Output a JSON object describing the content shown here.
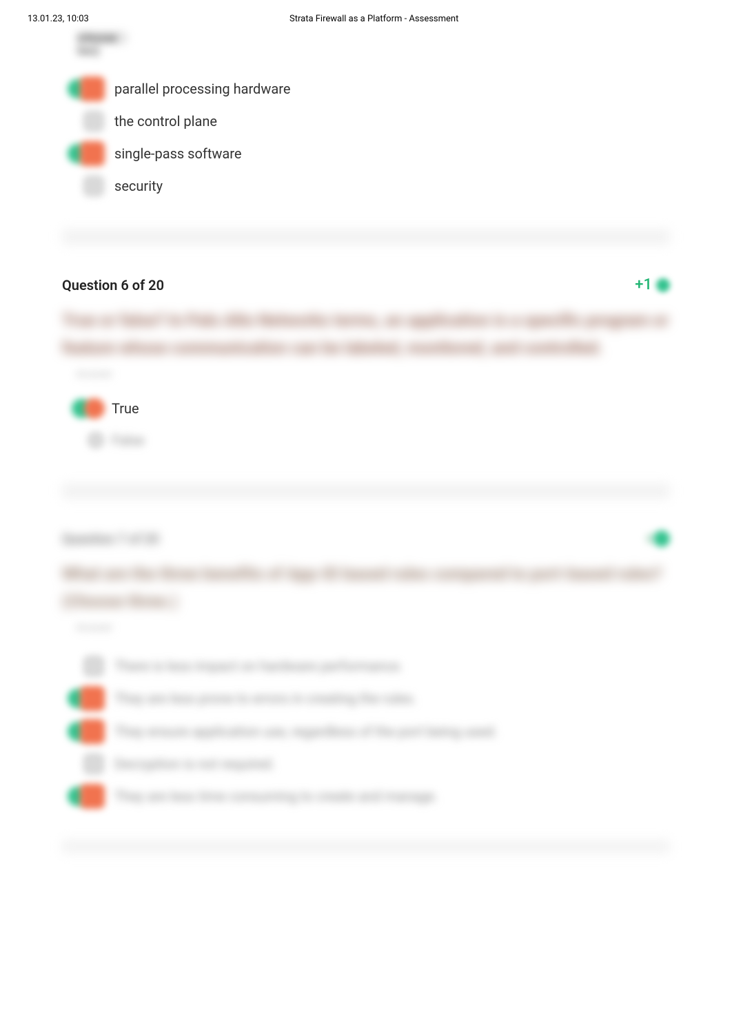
{
  "header": {
    "datetime": "13.01.23, 10:03",
    "title": "Strata Firewall as a Platform - Assessment"
  },
  "q5": {
    "hint": "(choose two)",
    "options": [
      {
        "text": "parallel processing hardware",
        "correct": true,
        "selected": true
      },
      {
        "text": "the control plane",
        "correct": false,
        "selected": false
      },
      {
        "text": "single-pass software",
        "correct": true,
        "selected": true
      },
      {
        "text": "security",
        "correct": false,
        "selected": false
      }
    ]
  },
  "q6": {
    "title": "Question 6 of 20",
    "score": "+1",
    "prompt": "True or false? In Palo Alto Networks terms, an application is a specific program or feature whose communication can be labeled, monitored, and controlled.",
    "hint": "Answer",
    "options": [
      {
        "text": "True",
        "correct": true,
        "selected": true
      },
      {
        "text": "False",
        "correct": false,
        "selected": false
      }
    ]
  },
  "q7": {
    "title": "Question 7 of 20",
    "score": "+1",
    "prompt": "What are the three benefits of App-ID based rules compared to port-based rules? (Choose three.)",
    "hint": "Answer",
    "options": [
      {
        "text": "There is less impact on hardware performance.",
        "selected": false
      },
      {
        "text": "They are less prone to errors in creating the rules.",
        "selected": true
      },
      {
        "text": "They ensure application use, regardless of the port being used.",
        "selected": true
      },
      {
        "text": "Decryption is not required.",
        "selected": false
      },
      {
        "text": "They are less time consuming to create and manage.",
        "selected": true
      }
    ]
  }
}
